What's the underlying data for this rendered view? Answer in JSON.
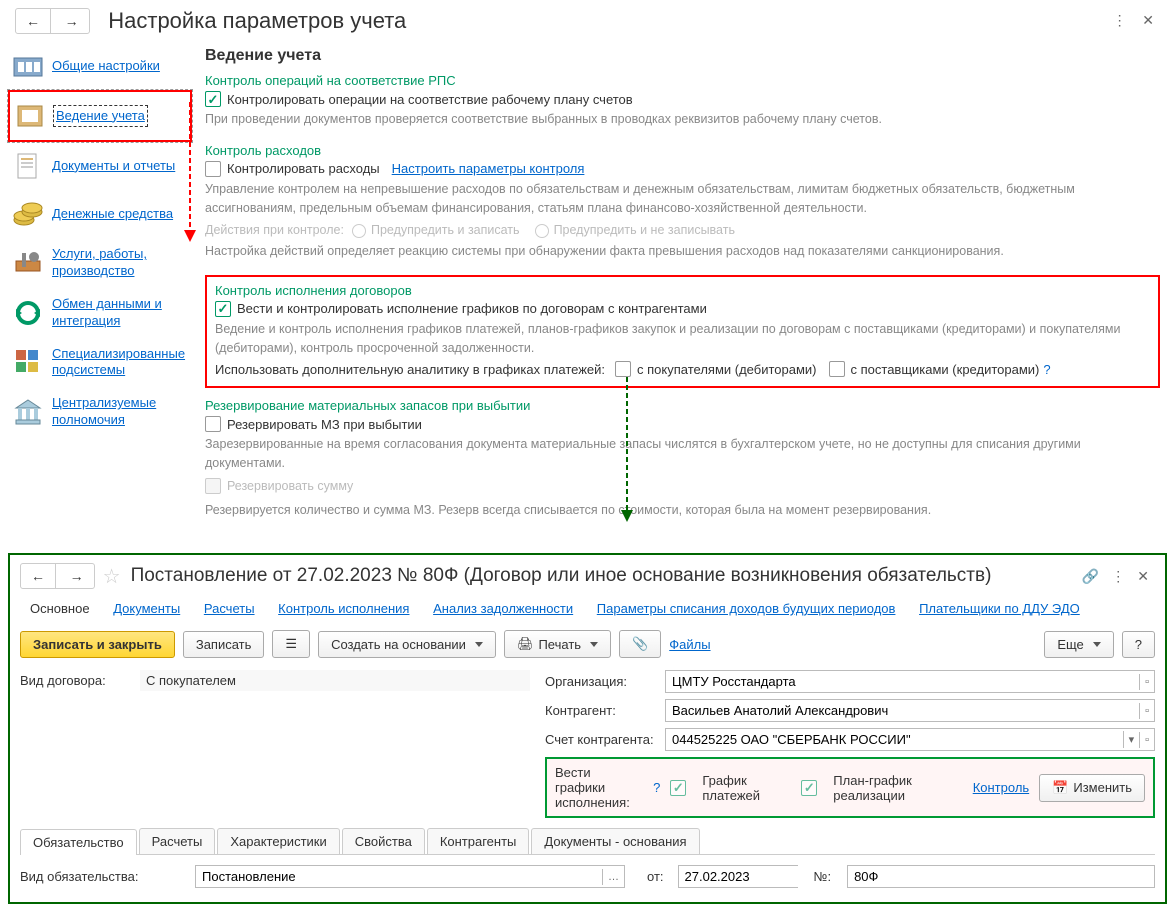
{
  "header": {
    "title": "Настройка параметров учета"
  },
  "sidebar": {
    "items": [
      {
        "label": "Общие настройки"
      },
      {
        "label": "Ведение учета"
      },
      {
        "label": "Документы и отчеты"
      },
      {
        "label": "Денежные средства"
      },
      {
        "label": "Услуги, работы, производство"
      },
      {
        "label": "Обмен данными и интеграция"
      },
      {
        "label": "Специализированные подсистемы"
      },
      {
        "label": "Централизуемые полномочия"
      }
    ]
  },
  "content": {
    "title": "Ведение учета",
    "s1": {
      "head": "Контроль операций на соответствие РПС",
      "chk": "Контролировать операции на соответствие рабочему плану счетов",
      "desc": "При проведении документов проверяется соответствие выбранных в проводках реквизитов рабочему плану счетов."
    },
    "s2": {
      "head": "Контроль расходов",
      "chk": "Контролировать расходы",
      "link": "Настроить параметры контроля",
      "desc": "Управление контролем на непревышение расходов по обязательствам и денежным обязательствам, лимитам бюджетных обязательств, бюджетным ассигнованиям, предельным объемам финансирования, статьям плана финансово-хозяйственной деятельности.",
      "act_label": "Действия при контроле:",
      "r1": "Предупредить и записать",
      "r2": "Предупредить и не записывать",
      "desc2": "Настройка действий определяет реакцию системы при обнаружении факта превышения расходов над показателями санкционирования."
    },
    "s3": {
      "head": "Контроль исполнения договоров",
      "chk": "Вести и контролировать исполнение графиков по договорам с контрагентами",
      "desc": "Ведение и контроль исполнения графиков платежей, планов-графиков закупок и реализации по договорам с поставщиками (кредиторами) и покупателями (дебиторами), контроль просроченной задолженности.",
      "an_label": "Использовать дополнительную аналитику в графиках платежей:",
      "c1": "с покупателями (дебиторами)",
      "c2": "с поставщиками (кредиторами)",
      "q": "?"
    },
    "s4": {
      "head": "Резервирование материальных запасов при выбытии",
      "chk": "Резервировать МЗ при выбытии",
      "desc": "Зарезервированные на время согласования документа материальные запасы числятся в бухгалтерском учете, но не доступны для списания другими документами.",
      "chk2": "Резервировать сумму",
      "desc2": "Резервируется количество и сумма МЗ. Резерв всегда списывается по стоимости, которая была на момент резервирования."
    }
  },
  "doc": {
    "title": "Постановление от 27.02.2023 № 80Ф (Договор или иное основание возникновения обязательств)",
    "tabs": [
      "Основное",
      "Документы",
      "Расчеты",
      "Контроль исполнения",
      "Анализ задолженности",
      "Параметры списания доходов будущих периодов",
      "Плательщики по ДДУ ЭДО"
    ],
    "buttons": {
      "save_close": "Записать и закрыть",
      "save": "Записать",
      "create": "Создать на основании",
      "print": "Печать",
      "files": "Файлы",
      "more": "Еще",
      "help": "?"
    },
    "fields": {
      "type_label": "Вид договора:",
      "type_value": "С покупателем",
      "org_label": "Организация:",
      "org_value": "ЦМТУ Росстандарта",
      "ctr_label": "Контрагент:",
      "ctr_value": "Васильев Анатолий Александрович",
      "acc_label": "Счет контрагента:",
      "acc_value": "044525225 ОАО \"СБЕРБАНК РОССИИ\""
    },
    "sched": {
      "label": "Вести графики исполнения:",
      "q": "?",
      "c1": "График платежей",
      "c2": "План-график реализации",
      "ctrl": "Контроль",
      "edit": "Изменить"
    },
    "subtabs": [
      "Обязательство",
      "Расчеты",
      "Характеристики",
      "Свойства",
      "Контрагенты",
      "Документы - основания"
    ],
    "oblig": {
      "type_label": "Вид обязательства:",
      "type_value": "Постановление",
      "from": "от:",
      "date": "27.02.2023",
      "num": "№:",
      "num_value": "80Ф"
    }
  }
}
